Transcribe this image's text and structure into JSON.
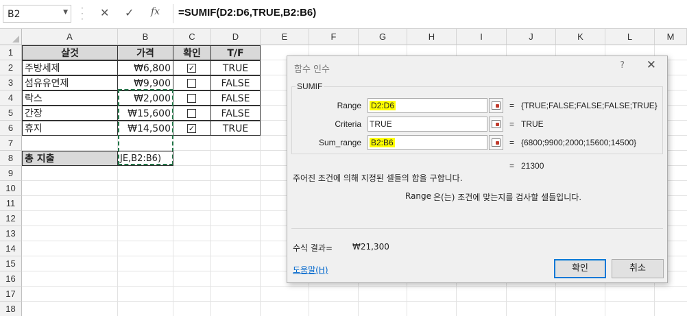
{
  "formula_bar": {
    "name_box": "B2",
    "cancel_icon": "✕",
    "enter_icon": "✓",
    "fx_icon": "fx",
    "formula": "=SUMIF(D2:D6,TRUE,B2:B6)"
  },
  "columns": [
    "A",
    "B",
    "C",
    "D",
    "E",
    "F",
    "G",
    "H",
    "I",
    "J",
    "K",
    "L",
    "M"
  ],
  "rows": [
    "1",
    "2",
    "3",
    "4",
    "5",
    "6",
    "7",
    "8",
    "9",
    "10",
    "11",
    "12",
    "13",
    "14",
    "15",
    "16",
    "17",
    "18"
  ],
  "table": {
    "headers": [
      "살것",
      "가격",
      "확인",
      "T/F"
    ],
    "rows": [
      {
        "item": "주방세제",
        "price": "₩6,800",
        "checked": true,
        "tf": "TRUE"
      },
      {
        "item": "섬유유연제",
        "price": "₩9,900",
        "checked": false,
        "tf": "FALSE"
      },
      {
        "item": "락스",
        "price": "₩2,000",
        "checked": false,
        "tf": "FALSE"
      },
      {
        "item": "간장",
        "price": "₩15,600",
        "checked": false,
        "tf": "FALSE"
      },
      {
        "item": "휴지",
        "price": "₩14,500",
        "checked": true,
        "tf": "TRUE"
      }
    ],
    "total_label": "총 지출",
    "total_edit": "JE,B2:B6)"
  },
  "dialog": {
    "title": "함수 인수",
    "help_q": "?",
    "close": "✕",
    "function_name": "SUMIF",
    "args": [
      {
        "label": "Range",
        "value": "D2:D6",
        "highlight": true,
        "result": "{TRUE;FALSE;FALSE;FALSE;TRUE}"
      },
      {
        "label": "Criteria",
        "value": "TRUE",
        "highlight": false,
        "result": "TRUE"
      },
      {
        "label": "Sum_range",
        "value": "B2:B6",
        "highlight": true,
        "result": "{6800;9900;2000;15600;14500}"
      }
    ],
    "equals": "=",
    "function_result": "21300",
    "description": "주어진 조건에 의해 지정된 셀들의 합을 구합니다.",
    "arg_description_name": "Range",
    "arg_description": "은(는) 조건에 맞는지를 검사할 셀들입니다.",
    "formula_result_label": "수식 결과=",
    "formula_result_value": "₩21,300",
    "help_link": "도움말(H)",
    "ok_label": "확인",
    "cancel_label": "취소"
  }
}
